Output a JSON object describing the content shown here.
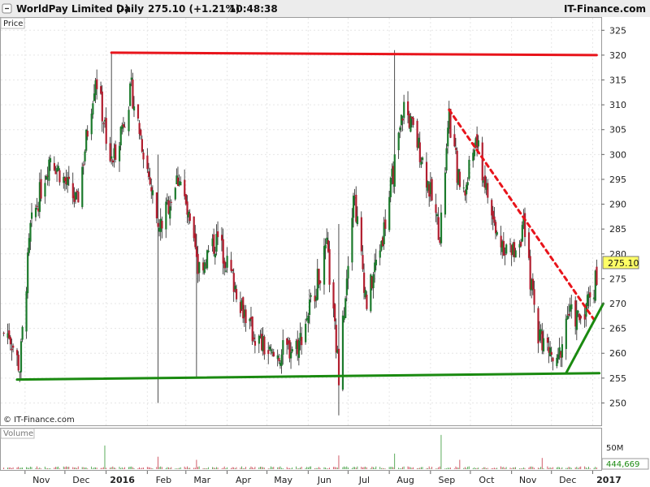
{
  "header": {
    "symbol": "WorldPay Limited (-)",
    "period": "Daily",
    "quote": "275.10 (+1.21%)",
    "time": "10:48:38",
    "brand": "IT-Finance.com"
  },
  "price_panel": {
    "label": "Price",
    "watermark": "© IT-Finance.com",
    "last_price": "275.10"
  },
  "volume_panel": {
    "label": "Volume",
    "last_volume": "444,669",
    "tick_label": "50M"
  },
  "colors": {
    "up": "#1c7a2c",
    "down": "#b21e2f",
    "resistance": "#e8141b",
    "support": "#1a8a10",
    "last_badge": "#ffff66"
  },
  "chart_data": {
    "type": "candlestick",
    "title": "WorldPay Limited (-)",
    "y_ticks": [
      250,
      255,
      260,
      265,
      270,
      275,
      280,
      285,
      290,
      295,
      300,
      305,
      310,
      315,
      320,
      325
    ],
    "ylim": [
      245.5,
      327.5
    ],
    "x_ticks": [
      "Nov",
      "Dec",
      "2016",
      "Feb",
      "Mar",
      "Apr",
      "May",
      "Jun",
      "Jul",
      "Aug",
      "Sep",
      "Oct",
      "Nov",
      "Dec",
      "2017"
    ],
    "x_range": [
      "2015-10-15",
      "2017-01-05"
    ],
    "approx_ohlc_keypoints": [
      {
        "date": "2015-10-20",
        "close": 264
      },
      {
        "date": "2015-10-28",
        "close": 257
      },
      {
        "date": "2015-11-05",
        "close": 285
      },
      {
        "date": "2015-11-20",
        "close": 300
      },
      {
        "date": "2015-12-10",
        "close": 290
      },
      {
        "date": "2015-12-24",
        "close": 316
      },
      {
        "date": "2016-01-05",
        "close": 298
      },
      {
        "date": "2016-01-20",
        "close": 313
      },
      {
        "date": "2016-02-10",
        "close": 285
      },
      {
        "date": "2016-02-25",
        "close": 296
      },
      {
        "date": "2016-03-10",
        "close": 277
      },
      {
        "date": "2016-03-25",
        "close": 283
      },
      {
        "date": "2016-04-20",
        "close": 264
      },
      {
        "date": "2016-05-05",
        "close": 259
      },
      {
        "date": "2016-05-25",
        "close": 262
      },
      {
        "date": "2016-06-15",
        "close": 281
      },
      {
        "date": "2016-06-24",
        "close": 256
      },
      {
        "date": "2016-07-05",
        "close": 293
      },
      {
        "date": "2016-07-15",
        "close": 270
      },
      {
        "date": "2016-07-28",
        "close": 285
      },
      {
        "date": "2016-08-08",
        "close": 303
      },
      {
        "date": "2016-08-12",
        "close": 310
      },
      {
        "date": "2016-08-25",
        "close": 300
      },
      {
        "date": "2016-09-08",
        "close": 284
      },
      {
        "date": "2016-09-15",
        "close": 307
      },
      {
        "date": "2016-09-25",
        "close": 290
      },
      {
        "date": "2016-10-05",
        "close": 303
      },
      {
        "date": "2016-10-20",
        "close": 284
      },
      {
        "date": "2016-11-01",
        "close": 280
      },
      {
        "date": "2016-11-10",
        "close": 285
      },
      {
        "date": "2016-11-20",
        "close": 265
      },
      {
        "date": "2016-12-05",
        "close": 257
      },
      {
        "date": "2016-12-13",
        "close": 268
      },
      {
        "date": "2016-12-22",
        "close": 267
      },
      {
        "date": "2016-12-29",
        "close": 271
      },
      {
        "date": "2017-01-04",
        "close": 275.1
      }
    ],
    "spikes": [
      {
        "date": "2016-01-05",
        "high": 320.5,
        "low": 300
      },
      {
        "date": "2016-02-09",
        "high": 300,
        "low": 250
      },
      {
        "date": "2016-03-09",
        "high": 284,
        "low": 255
      },
      {
        "date": "2016-06-24",
        "high": 286,
        "low": 247.5
      },
      {
        "date": "2016-08-05",
        "high": 321,
        "low": 301
      }
    ],
    "trendlines": [
      {
        "name": "resistance",
        "style": "solid",
        "color": "#e8141b",
        "points": [
          [
            "2016-01-05",
            320.5
          ],
          [
            "2017-01-04",
            320
          ]
        ]
      },
      {
        "name": "support",
        "style": "solid",
        "color": "#1a8a10",
        "points": [
          [
            "2015-10-26",
            254.7
          ],
          [
            "2017-01-06",
            256
          ]
        ]
      },
      {
        "name": "falling-trend",
        "style": "dashed",
        "color": "#e8141b",
        "points": [
          [
            "2016-09-15",
            309
          ],
          [
            "2017-01-04",
            266
          ]
        ]
      },
      {
        "name": "rising-trend",
        "style": "solid",
        "color": "#1a8a10",
        "points": [
          [
            "2016-12-12",
            256
          ],
          [
            "2017-01-09",
            270
          ]
        ]
      }
    ],
    "volume": {
      "typical": 2.5,
      "unit": "M",
      "spikes": [
        {
          "date": "2015-12-31",
          "value": 38
        },
        {
          "date": "2016-02-09",
          "value": 20
        },
        {
          "date": "2016-03-09",
          "value": 15
        },
        {
          "date": "2016-06-24",
          "value": 22
        },
        {
          "date": "2016-08-05",
          "value": 25
        },
        {
          "date": "2016-09-09",
          "value": 55
        },
        {
          "date": "2016-09-23",
          "value": 15
        },
        {
          "date": "2016-11-24",
          "value": 18
        }
      ],
      "last": 444669
    }
  }
}
